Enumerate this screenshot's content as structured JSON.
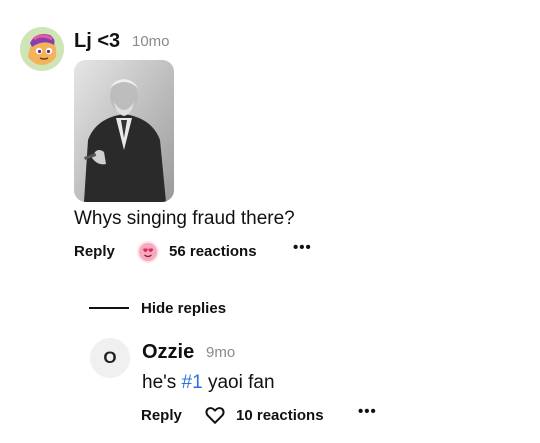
{
  "comment": {
    "username": "Lj <3",
    "timestamp": "10mo",
    "text": "Whys singing fraud there?",
    "reply_label": "Reply",
    "reactions_label": "56 reactions",
    "more_label": "•••"
  },
  "thread": {
    "hide_replies_label": "Hide replies"
  },
  "reply": {
    "avatar_initial": "O",
    "username": "Ozzie",
    "timestamp": "9mo",
    "text_before": "he's ",
    "hashtag": "#1",
    "text_after": " yaoi fan",
    "reply_label": "Reply",
    "reactions_label": "10 reactions",
    "more_label": "•••"
  },
  "icons": {
    "reaction_main": "heart-eyes-emoji-icon",
    "reaction_reply": "heart-outline-icon"
  }
}
